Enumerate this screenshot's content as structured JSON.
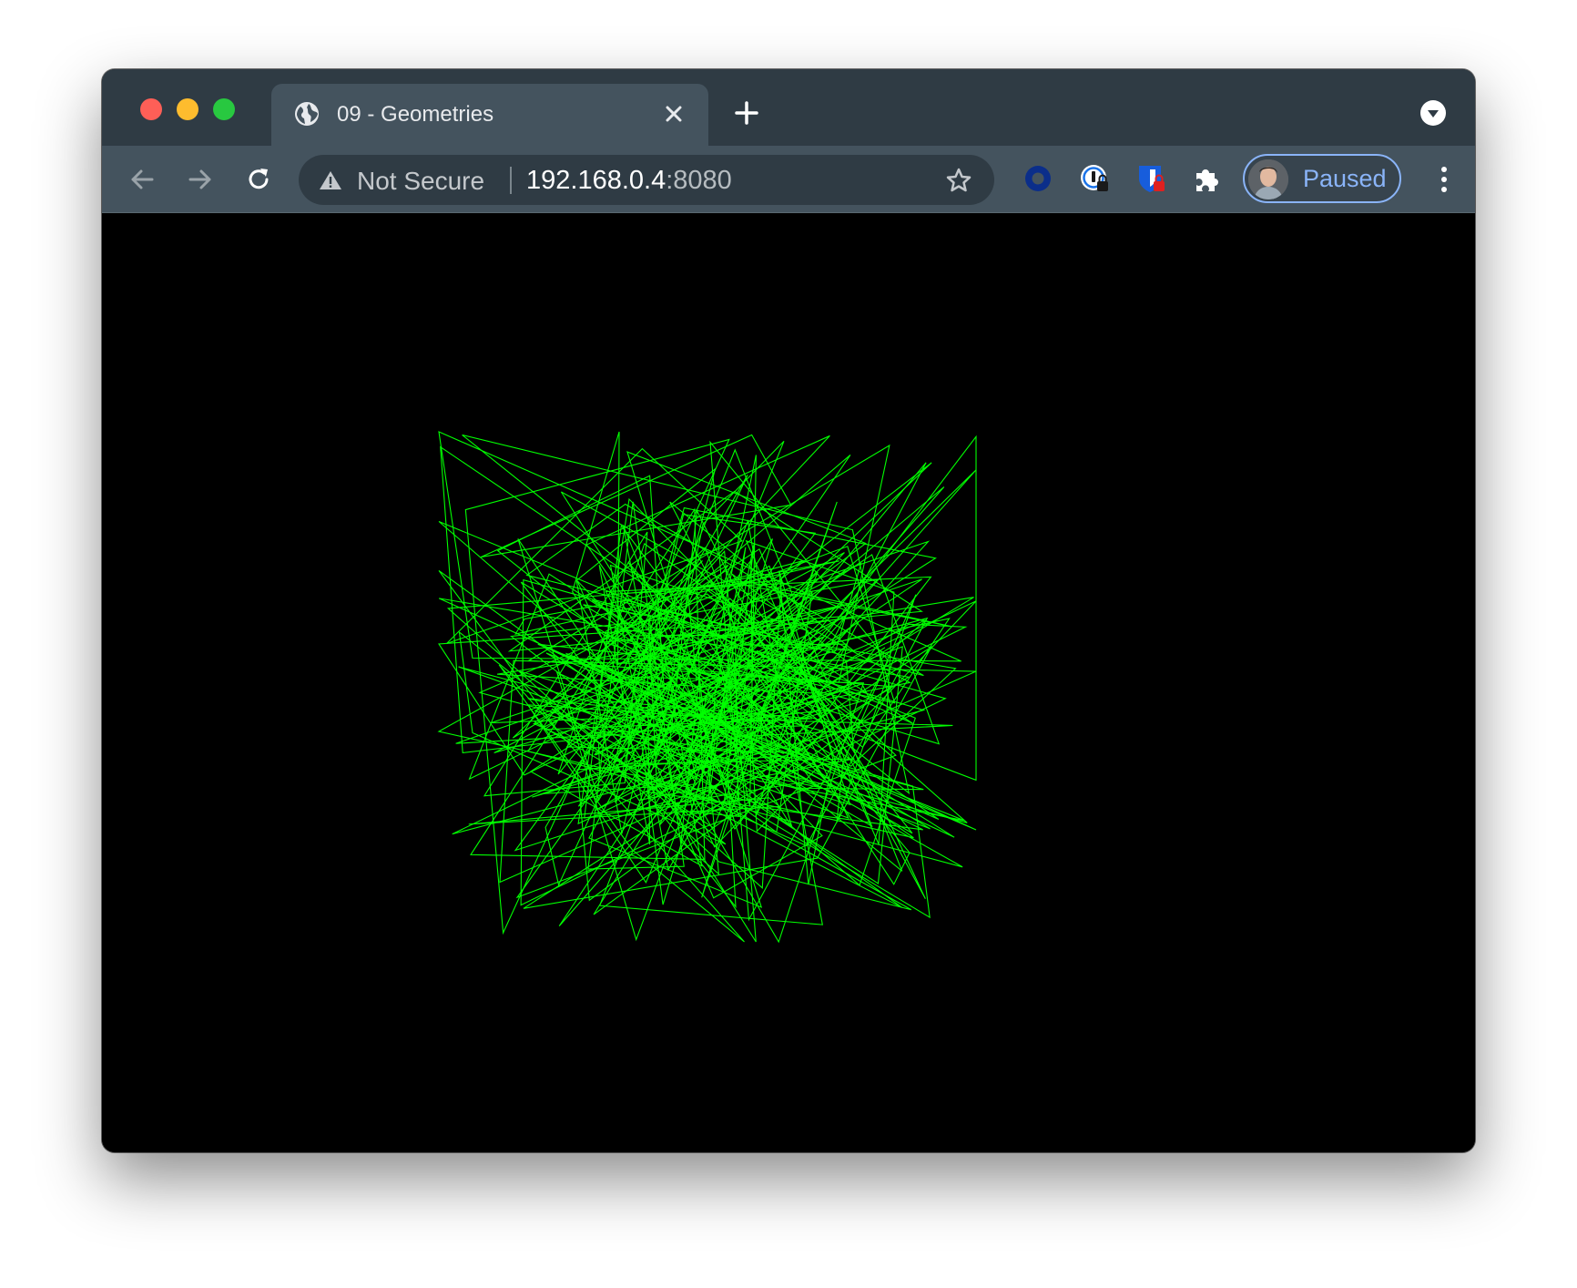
{
  "tab": {
    "title": "09 - Geometries",
    "favicon": "globe-icon"
  },
  "toolbar": {
    "security_label": "Not Secure",
    "url_host": "192.168.0.4",
    "url_port": ":8080"
  },
  "profile": {
    "label": "Paused"
  },
  "colors": {
    "tab_strip": "#2f3b44",
    "toolbar": "#44535e",
    "omnibox": "#2f3b44",
    "accent": "#8ab4f8",
    "canvas_background": "#000000",
    "wireframe": "#00ff00"
  },
  "icons": {
    "back": "arrow-left-icon",
    "forward": "arrow-right-icon",
    "reload": "reload-icon",
    "security": "warning-triangle-icon",
    "bookmark": "star-icon",
    "extension_1": "circle-ring-icon",
    "extension_2": "password-manager-icon",
    "extension_3": "shield-lock-icon",
    "extensions": "puzzle-icon",
    "menu": "kebab-menu-icon",
    "tab_search": "chevron-down-icon",
    "new_tab": "plus-icon",
    "close_tab": "close-icon"
  },
  "scene": {
    "description_type": "wireframe",
    "random_triangle_count": 50
  }
}
